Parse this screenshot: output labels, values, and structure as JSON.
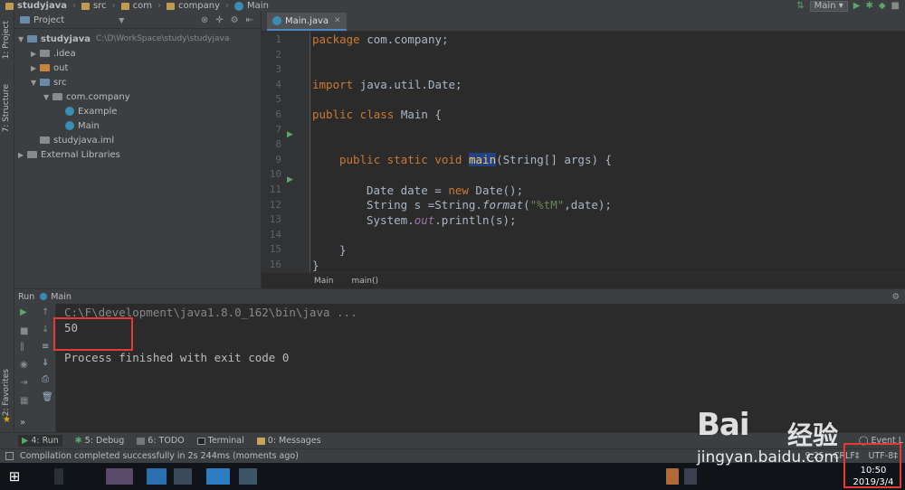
{
  "nav": {
    "crumbs": [
      "studyjava",
      "src",
      "com",
      "company",
      "Main"
    ],
    "run_config": "Main ▾"
  },
  "left_strip": {
    "project": "1: Project",
    "structure": "7: Structure",
    "favorites": "2: Favorites"
  },
  "project_panel": {
    "header": "Project",
    "tree": [
      {
        "label": "studyjava",
        "path": "C:\\D\\WorkSpace\\study\\studyjava",
        "indent": 0,
        "arrow": "▼",
        "kind": "module",
        "bold": true
      },
      {
        "label": ".idea",
        "indent": 1,
        "arrow": "▶",
        "kind": "folder-gray"
      },
      {
        "label": "out",
        "indent": 1,
        "arrow": "▶",
        "kind": "folder-orange"
      },
      {
        "label": "src",
        "indent": 1,
        "arrow": "▼",
        "kind": "folder-blue"
      },
      {
        "label": "com.company",
        "indent": 2,
        "arrow": "▼",
        "kind": "package"
      },
      {
        "label": "Example",
        "indent": 3,
        "arrow": "",
        "kind": "class"
      },
      {
        "label": "Main",
        "indent": 3,
        "arrow": "",
        "kind": "class"
      },
      {
        "label": "studyjava.iml",
        "indent": 1,
        "arrow": "",
        "kind": "file"
      },
      {
        "label": "External Libraries",
        "indent": 0,
        "arrow": "▶",
        "kind": "libs"
      }
    ]
  },
  "editor": {
    "tab": "Main.java",
    "line_numbers": [
      "1",
      "2",
      "3",
      "4",
      "5",
      "6",
      "7",
      "8",
      "9",
      "10",
      "11",
      "12",
      "13",
      "14",
      "15",
      "16"
    ],
    "code": {
      "l1_kw": "package ",
      "l1_rest": "com.company;",
      "l4_kw": "import ",
      "l4_rest": "java.util.Date;",
      "l6_kw": "public class ",
      "l6_rest": "Main {",
      "l9_kw": "public static void ",
      "l9_name": "main",
      "l9_rest": "(String[] args) {",
      "l11_a": "Date date = ",
      "l11_kw": "new ",
      "l11_b": "Date();",
      "l12_a": "String s =String.",
      "l12_fn": "format",
      "l12_b": "(",
      "l12_str": "\"%tM\"",
      "l12_c": ",date);",
      "l13_a": "System.",
      "l13_out": "out",
      "l13_b": ".println(s);",
      "l15": "}",
      "l16": "}"
    },
    "breadcrumb": [
      "Main",
      "main()"
    ]
  },
  "run_panel": {
    "label": "Run",
    "config": "Main",
    "console": {
      "cmd": "C:\\F\\development\\java1.8.0_162\\bin\\java ...",
      "output": "50",
      "finished": "Process finished with exit code 0"
    }
  },
  "bottom_tabs": [
    {
      "label": "4: Run"
    },
    {
      "label": "5: Debug"
    },
    {
      "label": "6: TODO"
    },
    {
      "label": "Terminal"
    },
    {
      "label": "0: Messages"
    }
  ],
  "event_log": "Event L",
  "status": {
    "message": "Compilation completed successfully in 2s 244ms (moments ago)",
    "position": "9:25",
    "line_sep": "CRLF‡",
    "encoding": "UTF-8‡"
  },
  "taskbar": {
    "time": "10:50",
    "date": "2019/3/4"
  },
  "watermark": {
    "brand": "Bai",
    "sub": "jingyan.baidu.com",
    "cn": "经验"
  }
}
